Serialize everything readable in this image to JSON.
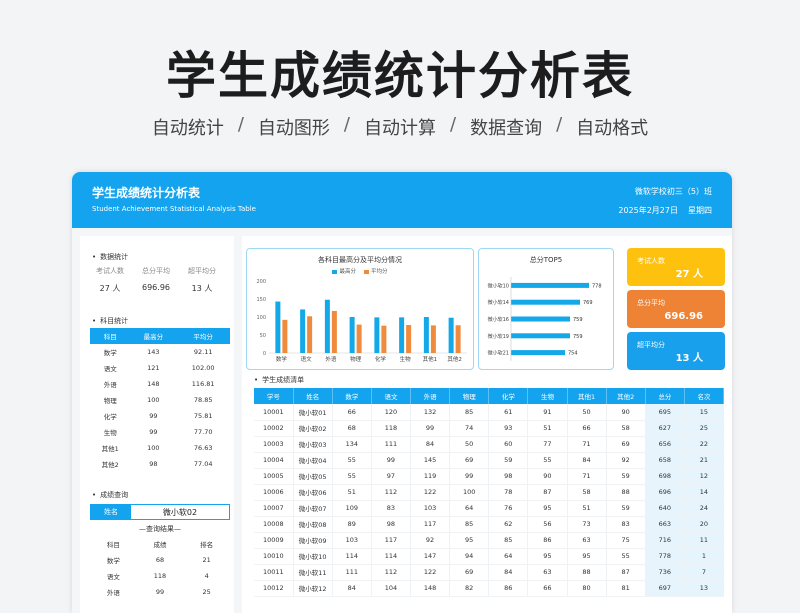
{
  "hero": {
    "title": "学生成绩统计分析表",
    "features": [
      "自动统计",
      "自动图形",
      "自动计算",
      "数据查询",
      "自动格式"
    ],
    "separator": "/"
  },
  "banner": {
    "title": "学生成绩统计分析表",
    "subtitle": "Student Achievement Statistical Analysis Table",
    "school": "微软学校初三（5）班",
    "date": "2025年2月27日",
    "weekday": "星期四"
  },
  "data_stats": {
    "heading": "数据统计",
    "labels": [
      "考试人数",
      "总分平均",
      "超平均分"
    ],
    "values": [
      "27 人",
      "696.96",
      "13 人"
    ]
  },
  "subject_stats": {
    "heading": "科目统计",
    "columns": [
      "科目",
      "最高分",
      "平均分"
    ],
    "rows": [
      [
        "数学",
        "143",
        "92.11"
      ],
      [
        "语文",
        "121",
        "102.00"
      ],
      [
        "外语",
        "148",
        "116.81"
      ],
      [
        "物理",
        "100",
        "78.85"
      ],
      [
        "化学",
        "99",
        "75.81"
      ],
      [
        "生物",
        "99",
        "77.70"
      ],
      [
        "其他1",
        "100",
        "76.63"
      ],
      [
        "其他2",
        "98",
        "77.04"
      ]
    ]
  },
  "query": {
    "heading": "成绩查询",
    "name_label": "姓名",
    "name_value": "微小软02",
    "result_title": "—查询结果—",
    "columns": [
      "科目",
      "成绩",
      "排名"
    ],
    "rows": [
      [
        "数学",
        "68",
        "21"
      ],
      [
        "语文",
        "118",
        "4"
      ],
      [
        "外语",
        "99",
        "25"
      ]
    ]
  },
  "bar_chart": {
    "title": "各科目最高分及平均分情况",
    "legend": [
      "最高分",
      "平均分"
    ],
    "colors": [
      "#13a9e8",
      "#f08a3c"
    ]
  },
  "top5": {
    "title": "总分TOP5",
    "color": "#13a9e8"
  },
  "kpis": [
    {
      "label": "考试人数",
      "value": "27 人",
      "color": "#fdc10e"
    },
    {
      "label": "总分平均",
      "value": "696.96",
      "color": "#ee8235"
    },
    {
      "label": "超平均分",
      "value": "13 人",
      "color": "#18a0ed"
    }
  ],
  "score_list": {
    "heading": "学生成绩清单",
    "columns": [
      "学号",
      "姓名",
      "数学",
      "语文",
      "外语",
      "物理",
      "化学",
      "生物",
      "其他1",
      "其他2",
      "总分",
      "名次"
    ],
    "rows": [
      [
        "10001",
        "微小软01",
        "66",
        "120",
        "132",
        "85",
        "61",
        "91",
        "50",
        "90",
        "695",
        "15"
      ],
      [
        "10002",
        "微小软02",
        "68",
        "118",
        "99",
        "74",
        "93",
        "51",
        "66",
        "58",
        "627",
        "25"
      ],
      [
        "10003",
        "微小软03",
        "134",
        "111",
        "84",
        "50",
        "60",
        "77",
        "71",
        "69",
        "656",
        "22"
      ],
      [
        "10004",
        "微小软04",
        "55",
        "99",
        "145",
        "69",
        "59",
        "55",
        "84",
        "92",
        "658",
        "21"
      ],
      [
        "10005",
        "微小软05",
        "55",
        "97",
        "119",
        "99",
        "98",
        "90",
        "71",
        "59",
        "698",
        "12"
      ],
      [
        "10006",
        "微小软06",
        "51",
        "112",
        "122",
        "100",
        "78",
        "87",
        "58",
        "88",
        "696",
        "14"
      ],
      [
        "10007",
        "微小软07",
        "109",
        "83",
        "103",
        "64",
        "76",
        "95",
        "51",
        "59",
        "640",
        "24"
      ],
      [
        "10008",
        "微小软08",
        "89",
        "98",
        "117",
        "85",
        "62",
        "56",
        "73",
        "83",
        "663",
        "20"
      ],
      [
        "10009",
        "微小软09",
        "103",
        "117",
        "92",
        "95",
        "85",
        "86",
        "63",
        "75",
        "716",
        "11"
      ],
      [
        "10010",
        "微小软10",
        "114",
        "114",
        "147",
        "94",
        "64",
        "95",
        "95",
        "55",
        "778",
        "1"
      ],
      [
        "10011",
        "微小软11",
        "111",
        "112",
        "122",
        "69",
        "84",
        "63",
        "88",
        "87",
        "736",
        "7"
      ],
      [
        "10012",
        "微小软12",
        "84",
        "104",
        "148",
        "82",
        "86",
        "66",
        "80",
        "81",
        "697",
        "13"
      ]
    ]
  },
  "chart_data": [
    {
      "type": "bar",
      "title": "各科目最高分及平均分情况",
      "categories": [
        "数学",
        "语文",
        "外语",
        "物理",
        "化学",
        "生物",
        "其他1",
        "其他2"
      ],
      "series": [
        {
          "name": "最高分",
          "values": [
            143,
            121,
            148,
            100,
            99,
            99,
            100,
            98
          ]
        },
        {
          "name": "平均分",
          "values": [
            92.11,
            102.0,
            116.81,
            78.85,
            75.81,
            77.7,
            76.63,
            77.04
          ]
        }
      ],
      "ylim": [
        0,
        200
      ],
      "yticks": [
        0,
        50,
        100,
        150,
        200
      ],
      "legend": "top-center",
      "grid": false
    },
    {
      "type": "bar",
      "orientation": "horizontal",
      "title": "总分TOP5",
      "categories": [
        "微小软10",
        "微小软14",
        "微小软16",
        "微小软19",
        "微小软21"
      ],
      "values": [
        778,
        769,
        759,
        759,
        754
      ],
      "xlim": [
        700,
        780
      ]
    }
  ]
}
